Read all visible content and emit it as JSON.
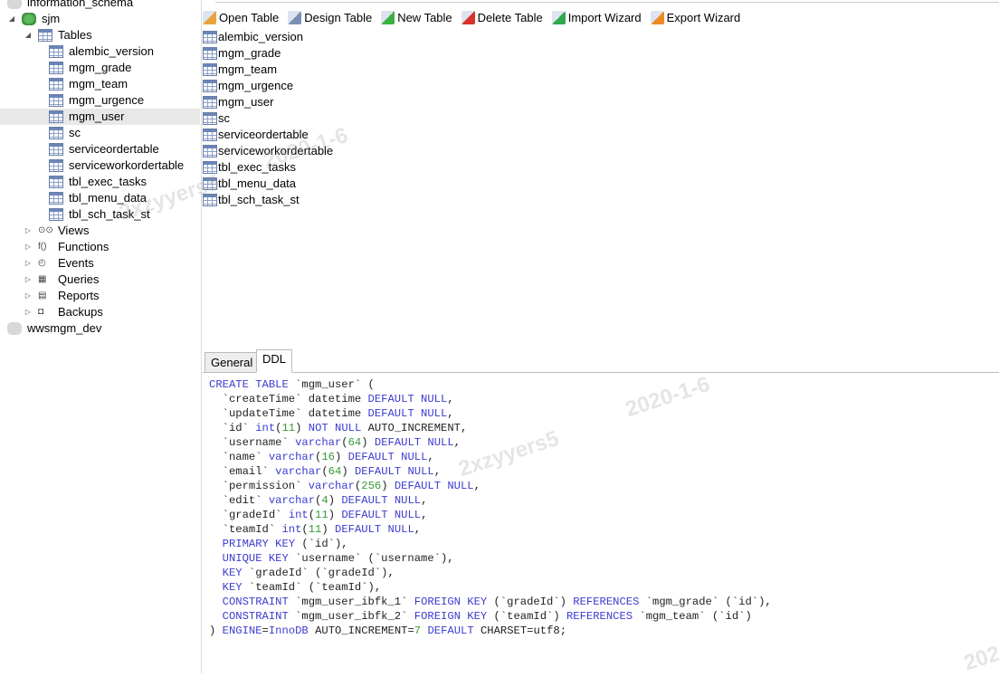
{
  "sidebar": {
    "items": [
      {
        "label": "information_schema",
        "level": 0,
        "icon": "database-gray-icon"
      },
      {
        "label": "sjm",
        "level": 0,
        "icon": "database-green-icon",
        "expanded": true
      },
      {
        "label": "Tables",
        "level": 1,
        "icon": "tables-icon",
        "expanded": true
      },
      {
        "label": "alembic_version",
        "level": 2,
        "icon": "table-icon"
      },
      {
        "label": "mgm_grade",
        "level": 2,
        "icon": "table-icon"
      },
      {
        "label": "mgm_team",
        "level": 2,
        "icon": "table-icon"
      },
      {
        "label": "mgm_urgence",
        "level": 2,
        "icon": "table-icon"
      },
      {
        "label": "mgm_user",
        "level": 2,
        "icon": "table-icon",
        "selected": true
      },
      {
        "label": "sc",
        "level": 2,
        "icon": "table-icon"
      },
      {
        "label": "serviceordertable",
        "level": 2,
        "icon": "table-icon"
      },
      {
        "label": "serviceworkordertable",
        "level": 2,
        "icon": "table-icon"
      },
      {
        "label": "tbl_exec_tasks",
        "level": 2,
        "icon": "table-icon"
      },
      {
        "label": "tbl_menu_data",
        "level": 2,
        "icon": "table-icon"
      },
      {
        "label": "tbl_sch_task_st",
        "level": 2,
        "icon": "table-icon"
      },
      {
        "label": "Views",
        "level": 1,
        "icon": "views-icon",
        "collapsed": true
      },
      {
        "label": "Functions",
        "level": 1,
        "icon": "functions-icon",
        "collapsed": true
      },
      {
        "label": "Events",
        "level": 1,
        "icon": "events-icon",
        "collapsed": true
      },
      {
        "label": "Queries",
        "level": 1,
        "icon": "queries-icon",
        "collapsed": true
      },
      {
        "label": "Reports",
        "level": 1,
        "icon": "reports-icon",
        "collapsed": true
      },
      {
        "label": "Backups",
        "level": 1,
        "icon": "backups-icon",
        "collapsed": true
      },
      {
        "label": "wwsmgm_dev",
        "level": 0,
        "icon": "database-gray-icon"
      }
    ]
  },
  "toolbar": [
    {
      "label": "Open Table",
      "icon": "open-table-icon",
      "color": "#e8a33c"
    },
    {
      "label": "Design Table",
      "icon": "design-table-icon",
      "color": "#7a8fb5"
    },
    {
      "label": "New Table",
      "icon": "new-table-icon",
      "color": "#3cb043"
    },
    {
      "label": "Delete Table",
      "icon": "delete-table-icon",
      "color": "#d9312b"
    },
    {
      "label": "Import Wizard",
      "icon": "import-wizard-icon",
      "color": "#2fa84f"
    },
    {
      "label": "Export Wizard",
      "icon": "export-wizard-icon",
      "color": "#f08a24"
    }
  ],
  "objects": [
    "alembic_version",
    "mgm_grade",
    "mgm_team",
    "mgm_urgence",
    "mgm_user",
    "sc",
    "serviceordertable",
    "serviceworkordertable",
    "tbl_exec_tasks",
    "tbl_menu_data",
    "tbl_sch_task_st"
  ],
  "tabs": [
    {
      "label": "General",
      "active": false
    },
    {
      "label": "DDL",
      "active": true
    }
  ],
  "ddl": [
    [
      [
        "CREATE TABLE",
        "k"
      ],
      [
        " `mgm_user` (",
        "p"
      ]
    ],
    [
      [
        "  `createTime` datetime ",
        "p"
      ],
      [
        "DEFAULT NULL",
        "k"
      ],
      [
        ",",
        "p"
      ]
    ],
    [
      [
        "  `updateTime` datetime ",
        "p"
      ],
      [
        "DEFAULT NULL",
        "k"
      ],
      [
        ",",
        "p"
      ]
    ],
    [
      [
        "  `id` ",
        "p"
      ],
      [
        "int",
        "k"
      ],
      [
        "(",
        "p"
      ],
      [
        "11",
        "n"
      ],
      [
        ") ",
        "p"
      ],
      [
        "NOT NULL",
        "k"
      ],
      [
        " AUTO_INCREMENT,",
        "p"
      ]
    ],
    [
      [
        "  `username` ",
        "p"
      ],
      [
        "varchar",
        "k"
      ],
      [
        "(",
        "p"
      ],
      [
        "64",
        "n"
      ],
      [
        ") ",
        "p"
      ],
      [
        "DEFAULT NULL",
        "k"
      ],
      [
        ",",
        "p"
      ]
    ],
    [
      [
        "  `name` ",
        "p"
      ],
      [
        "varchar",
        "k"
      ],
      [
        "(",
        "p"
      ],
      [
        "16",
        "n"
      ],
      [
        ") ",
        "p"
      ],
      [
        "DEFAULT NULL",
        "k"
      ],
      [
        ",",
        "p"
      ]
    ],
    [
      [
        "  `email` ",
        "p"
      ],
      [
        "varchar",
        "k"
      ],
      [
        "(",
        "p"
      ],
      [
        "64",
        "n"
      ],
      [
        ") ",
        "p"
      ],
      [
        "DEFAULT NULL",
        "k"
      ],
      [
        ",",
        "p"
      ]
    ],
    [
      [
        "  `permission` ",
        "p"
      ],
      [
        "varchar",
        "k"
      ],
      [
        "(",
        "p"
      ],
      [
        "256",
        "n"
      ],
      [
        ") ",
        "p"
      ],
      [
        "DEFAULT NULL",
        "k"
      ],
      [
        ",",
        "p"
      ]
    ],
    [
      [
        "  `edit` ",
        "p"
      ],
      [
        "varchar",
        "k"
      ],
      [
        "(",
        "p"
      ],
      [
        "4",
        "n"
      ],
      [
        ") ",
        "p"
      ],
      [
        "DEFAULT NULL",
        "k"
      ],
      [
        ",",
        "p"
      ]
    ],
    [
      [
        "  `gradeId` ",
        "p"
      ],
      [
        "int",
        "k"
      ],
      [
        "(",
        "p"
      ],
      [
        "11",
        "n"
      ],
      [
        ") ",
        "p"
      ],
      [
        "DEFAULT NULL",
        "k"
      ],
      [
        ",",
        "p"
      ]
    ],
    [
      [
        "  `teamId` ",
        "p"
      ],
      [
        "int",
        "k"
      ],
      [
        "(",
        "p"
      ],
      [
        "11",
        "n"
      ],
      [
        ") ",
        "p"
      ],
      [
        "DEFAULT NULL",
        "k"
      ],
      [
        ",",
        "p"
      ]
    ],
    [
      [
        "  ",
        "p"
      ],
      [
        "PRIMARY KEY",
        "k"
      ],
      [
        " (`id`),",
        "p"
      ]
    ],
    [
      [
        "  ",
        "p"
      ],
      [
        "UNIQUE KEY",
        "k"
      ],
      [
        " `username` (`username`),",
        "p"
      ]
    ],
    [
      [
        "  ",
        "p"
      ],
      [
        "KEY",
        "k"
      ],
      [
        " `gradeId` (`gradeId`),",
        "p"
      ]
    ],
    [
      [
        "  ",
        "p"
      ],
      [
        "KEY",
        "k"
      ],
      [
        " `teamId` (`teamId`),",
        "p"
      ]
    ],
    [
      [
        "  ",
        "p"
      ],
      [
        "CONSTRAINT",
        "k"
      ],
      [
        " `mgm_user_ibfk_1` ",
        "p"
      ],
      [
        "FOREIGN KEY",
        "k"
      ],
      [
        " (`gradeId`) ",
        "p"
      ],
      [
        "REFERENCES",
        "k"
      ],
      [
        " `mgm_grade` (`id`),",
        "p"
      ]
    ],
    [
      [
        "  ",
        "p"
      ],
      [
        "CONSTRAINT",
        "k"
      ],
      [
        " `mgm_user_ibfk_2` ",
        "p"
      ],
      [
        "FOREIGN KEY",
        "k"
      ],
      [
        " (`teamId`) ",
        "p"
      ],
      [
        "REFERENCES",
        "k"
      ],
      [
        " `mgm_team` (`id`)",
        "p"
      ]
    ],
    [
      [
        ") ",
        "p"
      ],
      [
        "ENGINE",
        "k"
      ],
      [
        "=",
        "p"
      ],
      [
        "InnoDB",
        "k"
      ],
      [
        " AUTO_INCREMENT=",
        "p"
      ],
      [
        "7",
        "n"
      ],
      [
        " ",
        "p"
      ],
      [
        "DEFAULT",
        "k"
      ],
      [
        " CHARSET=utf8;",
        "p"
      ]
    ]
  ],
  "watermarks": [
    "2020-1-6",
    "2xzyyers5"
  ]
}
